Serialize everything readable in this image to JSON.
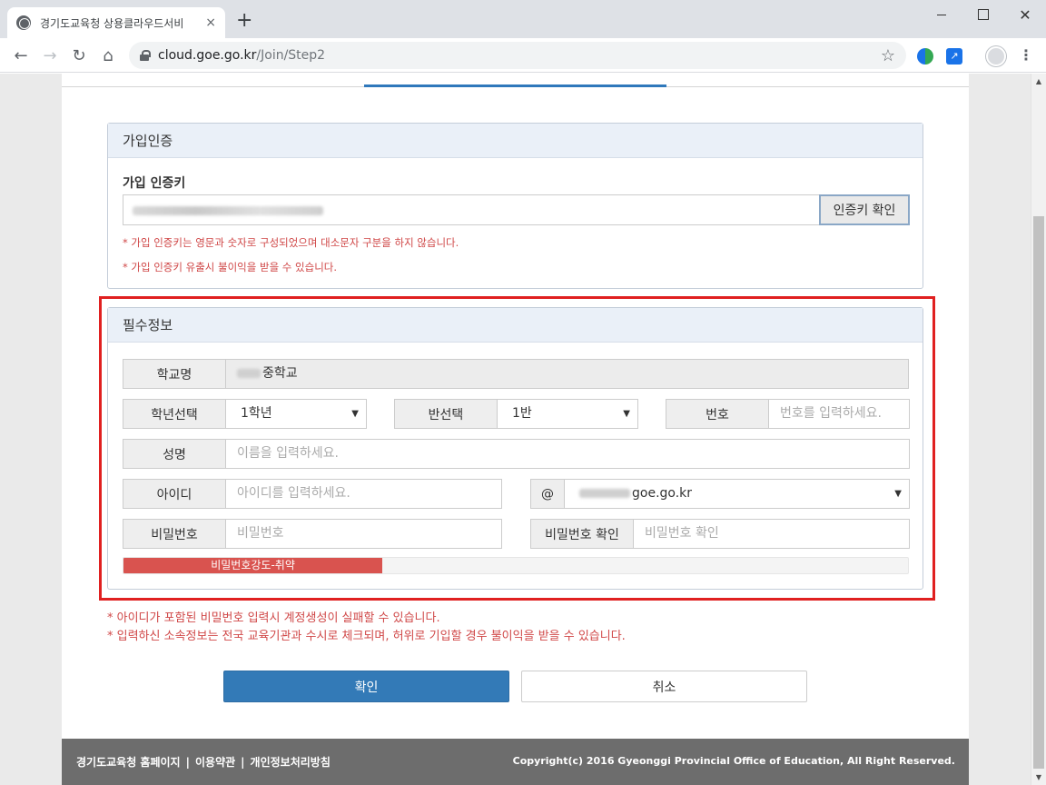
{
  "browser": {
    "tab_title": "경기도교육청 상용클라우드서비",
    "tab_close": "×",
    "new_tab": "+",
    "url_host": "cloud.goe.go.kr",
    "url_path": "/Join/Step2",
    "window_close": "✕",
    "icons": [
      "globe-icon",
      "lock-icon",
      "star-icon",
      "profile-icon",
      "menu-icon"
    ]
  },
  "auth_panel": {
    "title": "가입인증",
    "key_label": "가입 인증키",
    "verify_button": "인증키 확인",
    "notes": [
      "* 가입 인증키는 영문과 숫자로 구성되었으며 대소문자 구분을 하지 않습니다.",
      "* 가입 인증키 유출시 불이익을 받을 수 있습니다."
    ]
  },
  "required_panel": {
    "title": "필수정보",
    "school": {
      "label": "학교명",
      "value": "중학교"
    },
    "grade": {
      "label": "학년선택",
      "value": "1학년"
    },
    "class": {
      "label": "반선택",
      "value": "1반"
    },
    "number": {
      "label": "번호",
      "placeholder": "번호를 입력하세요."
    },
    "name": {
      "label": "성명",
      "placeholder": "이름을 입력하세요."
    },
    "userid": {
      "label": "아이디",
      "placeholder": "아이디를 입력하세요."
    },
    "domain": {
      "at": "@",
      "value": "goe.go.kr"
    },
    "password": {
      "label": "비밀번호",
      "placeholder": "비밀번호"
    },
    "password_confirm": {
      "label": "비밀번호 확인",
      "placeholder": "비밀번호 확인"
    },
    "strength": {
      "label": "비밀번호강도-취약",
      "level_percent": 33,
      "color": "#d9534f"
    }
  },
  "notices": [
    "* 아이디가 포함된 비밀번호 입력시 계정생성이 실패할 수 있습니다.",
    "* 입력하신 소속정보는 전국 교육기관과 수시로 체크되며, 허위로 기입할 경우 불이익을 받을 수 있습니다."
  ],
  "buttons": {
    "confirm": "확인",
    "cancel": "취소"
  },
  "footer": {
    "links": [
      "경기도교육청 홈페이지",
      "이용약관",
      "개인정보처리방침"
    ],
    "separator": "|",
    "copyright": "Copyright(c) 2016 Gyeonggi Provincial Office of Education, All Right Reserved."
  },
  "colors": {
    "primary": "#337ab7",
    "warning": "#d04848",
    "highlight": "#e02020",
    "footer_bg": "#6d6d6d"
  }
}
